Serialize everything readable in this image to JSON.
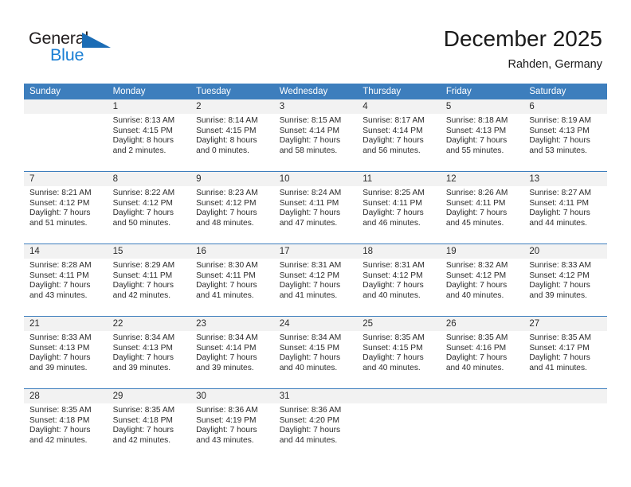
{
  "logo": {
    "word_top": "General",
    "word_bottom": "Blue",
    "triangle_icon": "triangle-icon",
    "color_dark": "#231f20",
    "color_blue": "#1b7fd4",
    "color_triangle": "#1b6cb5"
  },
  "header": {
    "title": "December 2025",
    "subtitle": "Rahden, Germany"
  },
  "theme": {
    "header_bar": "#3d7ebd",
    "daynum_band": "#f2f2f2",
    "text": "#2b2b2b"
  },
  "calendar": {
    "weekdays": [
      "Sunday",
      "Monday",
      "Tuesday",
      "Wednesday",
      "Thursday",
      "Friday",
      "Saturday"
    ],
    "weeks": [
      [
        {
          "day": "",
          "sunrise": "",
          "sunset": "",
          "daylight_line1": "",
          "daylight_line2": ""
        },
        {
          "day": "1",
          "sunrise": "Sunrise: 8:13 AM",
          "sunset": "Sunset: 4:15 PM",
          "daylight_line1": "Daylight: 8 hours",
          "daylight_line2": "and 2 minutes."
        },
        {
          "day": "2",
          "sunrise": "Sunrise: 8:14 AM",
          "sunset": "Sunset: 4:15 PM",
          "daylight_line1": "Daylight: 8 hours",
          "daylight_line2": "and 0 minutes."
        },
        {
          "day": "3",
          "sunrise": "Sunrise: 8:15 AM",
          "sunset": "Sunset: 4:14 PM",
          "daylight_line1": "Daylight: 7 hours",
          "daylight_line2": "and 58 minutes."
        },
        {
          "day": "4",
          "sunrise": "Sunrise: 8:17 AM",
          "sunset": "Sunset: 4:14 PM",
          "daylight_line1": "Daylight: 7 hours",
          "daylight_line2": "and 56 minutes."
        },
        {
          "day": "5",
          "sunrise": "Sunrise: 8:18 AM",
          "sunset": "Sunset: 4:13 PM",
          "daylight_line1": "Daylight: 7 hours",
          "daylight_line2": "and 55 minutes."
        },
        {
          "day": "6",
          "sunrise": "Sunrise: 8:19 AM",
          "sunset": "Sunset: 4:13 PM",
          "daylight_line1": "Daylight: 7 hours",
          "daylight_line2": "and 53 minutes."
        }
      ],
      [
        {
          "day": "7",
          "sunrise": "Sunrise: 8:21 AM",
          "sunset": "Sunset: 4:12 PM",
          "daylight_line1": "Daylight: 7 hours",
          "daylight_line2": "and 51 minutes."
        },
        {
          "day": "8",
          "sunrise": "Sunrise: 8:22 AM",
          "sunset": "Sunset: 4:12 PM",
          "daylight_line1": "Daylight: 7 hours",
          "daylight_line2": "and 50 minutes."
        },
        {
          "day": "9",
          "sunrise": "Sunrise: 8:23 AM",
          "sunset": "Sunset: 4:12 PM",
          "daylight_line1": "Daylight: 7 hours",
          "daylight_line2": "and 48 minutes."
        },
        {
          "day": "10",
          "sunrise": "Sunrise: 8:24 AM",
          "sunset": "Sunset: 4:11 PM",
          "daylight_line1": "Daylight: 7 hours",
          "daylight_line2": "and 47 minutes."
        },
        {
          "day": "11",
          "sunrise": "Sunrise: 8:25 AM",
          "sunset": "Sunset: 4:11 PM",
          "daylight_line1": "Daylight: 7 hours",
          "daylight_line2": "and 46 minutes."
        },
        {
          "day": "12",
          "sunrise": "Sunrise: 8:26 AM",
          "sunset": "Sunset: 4:11 PM",
          "daylight_line1": "Daylight: 7 hours",
          "daylight_line2": "and 45 minutes."
        },
        {
          "day": "13",
          "sunrise": "Sunrise: 8:27 AM",
          "sunset": "Sunset: 4:11 PM",
          "daylight_line1": "Daylight: 7 hours",
          "daylight_line2": "and 44 minutes."
        }
      ],
      [
        {
          "day": "14",
          "sunrise": "Sunrise: 8:28 AM",
          "sunset": "Sunset: 4:11 PM",
          "daylight_line1": "Daylight: 7 hours",
          "daylight_line2": "and 43 minutes."
        },
        {
          "day": "15",
          "sunrise": "Sunrise: 8:29 AM",
          "sunset": "Sunset: 4:11 PM",
          "daylight_line1": "Daylight: 7 hours",
          "daylight_line2": "and 42 minutes."
        },
        {
          "day": "16",
          "sunrise": "Sunrise: 8:30 AM",
          "sunset": "Sunset: 4:11 PM",
          "daylight_line1": "Daylight: 7 hours",
          "daylight_line2": "and 41 minutes."
        },
        {
          "day": "17",
          "sunrise": "Sunrise: 8:31 AM",
          "sunset": "Sunset: 4:12 PM",
          "daylight_line1": "Daylight: 7 hours",
          "daylight_line2": "and 41 minutes."
        },
        {
          "day": "18",
          "sunrise": "Sunrise: 8:31 AM",
          "sunset": "Sunset: 4:12 PM",
          "daylight_line1": "Daylight: 7 hours",
          "daylight_line2": "and 40 minutes."
        },
        {
          "day": "19",
          "sunrise": "Sunrise: 8:32 AM",
          "sunset": "Sunset: 4:12 PM",
          "daylight_line1": "Daylight: 7 hours",
          "daylight_line2": "and 40 minutes."
        },
        {
          "day": "20",
          "sunrise": "Sunrise: 8:33 AM",
          "sunset": "Sunset: 4:12 PM",
          "daylight_line1": "Daylight: 7 hours",
          "daylight_line2": "and 39 minutes."
        }
      ],
      [
        {
          "day": "21",
          "sunrise": "Sunrise: 8:33 AM",
          "sunset": "Sunset: 4:13 PM",
          "daylight_line1": "Daylight: 7 hours",
          "daylight_line2": "and 39 minutes."
        },
        {
          "day": "22",
          "sunrise": "Sunrise: 8:34 AM",
          "sunset": "Sunset: 4:13 PM",
          "daylight_line1": "Daylight: 7 hours",
          "daylight_line2": "and 39 minutes."
        },
        {
          "day": "23",
          "sunrise": "Sunrise: 8:34 AM",
          "sunset": "Sunset: 4:14 PM",
          "daylight_line1": "Daylight: 7 hours",
          "daylight_line2": "and 39 minutes."
        },
        {
          "day": "24",
          "sunrise": "Sunrise: 8:34 AM",
          "sunset": "Sunset: 4:15 PM",
          "daylight_line1": "Daylight: 7 hours",
          "daylight_line2": "and 40 minutes."
        },
        {
          "day": "25",
          "sunrise": "Sunrise: 8:35 AM",
          "sunset": "Sunset: 4:15 PM",
          "daylight_line1": "Daylight: 7 hours",
          "daylight_line2": "and 40 minutes."
        },
        {
          "day": "26",
          "sunrise": "Sunrise: 8:35 AM",
          "sunset": "Sunset: 4:16 PM",
          "daylight_line1": "Daylight: 7 hours",
          "daylight_line2": "and 40 minutes."
        },
        {
          "day": "27",
          "sunrise": "Sunrise: 8:35 AM",
          "sunset": "Sunset: 4:17 PM",
          "daylight_line1": "Daylight: 7 hours",
          "daylight_line2": "and 41 minutes."
        }
      ],
      [
        {
          "day": "28",
          "sunrise": "Sunrise: 8:35 AM",
          "sunset": "Sunset: 4:18 PM",
          "daylight_line1": "Daylight: 7 hours",
          "daylight_line2": "and 42 minutes."
        },
        {
          "day": "29",
          "sunrise": "Sunrise: 8:35 AM",
          "sunset": "Sunset: 4:18 PM",
          "daylight_line1": "Daylight: 7 hours",
          "daylight_line2": "and 42 minutes."
        },
        {
          "day": "30",
          "sunrise": "Sunrise: 8:36 AM",
          "sunset": "Sunset: 4:19 PM",
          "daylight_line1": "Daylight: 7 hours",
          "daylight_line2": "and 43 minutes."
        },
        {
          "day": "31",
          "sunrise": "Sunrise: 8:36 AM",
          "sunset": "Sunset: 4:20 PM",
          "daylight_line1": "Daylight: 7 hours",
          "daylight_line2": "and 44 minutes."
        },
        {
          "day": "",
          "sunrise": "",
          "sunset": "",
          "daylight_line1": "",
          "daylight_line2": ""
        },
        {
          "day": "",
          "sunrise": "",
          "sunset": "",
          "daylight_line1": "",
          "daylight_line2": ""
        },
        {
          "day": "",
          "sunrise": "",
          "sunset": "",
          "daylight_line1": "",
          "daylight_line2": ""
        }
      ]
    ]
  }
}
